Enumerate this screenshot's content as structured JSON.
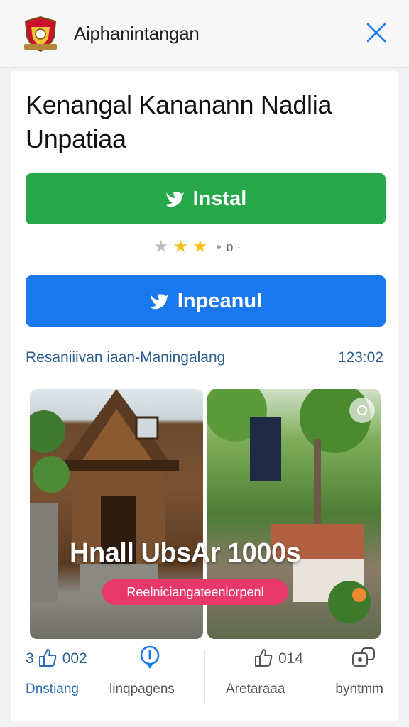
{
  "header": {
    "app_name": "Aiphanintangan",
    "logo_icon": "emblem-logo-icon",
    "close_icon": "close-icon",
    "accent_color": "#1a78ee"
  },
  "content": {
    "title": "Kenangal Kananann Nadlia Unpatiaa",
    "install_button": {
      "label": "Instal",
      "icon": "bird-icon",
      "color": "#26a84a"
    },
    "secondary_button": {
      "label": "Inpeanul",
      "icon": "bird-icon",
      "color": "#1a78ee"
    },
    "rating": {
      "stars_filled": 2,
      "stars_shown": 3,
      "text": "ɒ ·"
    },
    "info": {
      "left": "Resaniiivan iaan-Maningalang",
      "right": "123:02"
    }
  },
  "gallery": {
    "overlay_text": "Hnall  UbsAr 1000s",
    "pill_text": "Reelniciangateenlorpenl",
    "round_button_icon": "circle-icon"
  },
  "actions": [
    {
      "prefix": "3",
      "icon": "thumbs-up-icon",
      "count": "002",
      "label": "Dnstiang"
    },
    {
      "icon": "pin-icon",
      "label": "linqpagens"
    },
    {
      "icon": "thumbs-up-icon",
      "count": "014",
      "label": "Aretaraaa"
    },
    {
      "icon": "share-icon",
      "label": "byntmm"
    }
  ]
}
